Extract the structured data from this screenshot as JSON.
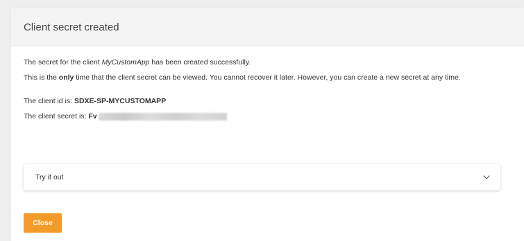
{
  "dialog": {
    "title": "Client secret created",
    "success_prefix": "The secret for the client ",
    "client_name": "MyCustomApp",
    "success_suffix": " has been created successfully.",
    "warning_prefix": "This is the ",
    "warning_emphasis": "only",
    "warning_suffix": " time that the client secret can be viewed. You cannot recover it later. However, you can create a new secret at any time.",
    "client_id_label": "The client id is: ",
    "client_id_value": "SDXE-SP-MYCUSTOMAPP",
    "client_secret_label": "The client secret is: ",
    "client_secret_visible": "Fv",
    "accordion_label": "Try it out",
    "close_label": "Close"
  },
  "colors": {
    "accent": "#f39b2a",
    "header_bg": "#f4f4f4",
    "page_bg": "#efefef"
  },
  "icons": {
    "accordion": "chevron-down-icon"
  }
}
